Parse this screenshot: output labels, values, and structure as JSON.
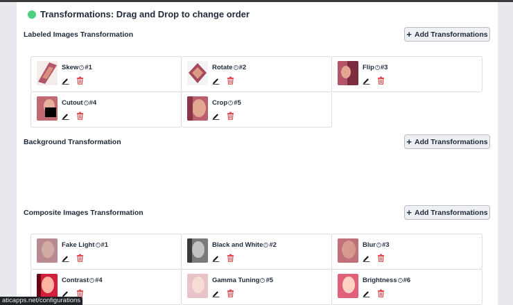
{
  "header": {
    "title": "Transformations: Drag and Drop to change order",
    "status_dot_color": "#4cd07d"
  },
  "sections": [
    {
      "title": "Labeled Images Transformation",
      "add_label": "Add Transformations",
      "cards": [
        {
          "name": "Skew",
          "order": "#1",
          "thumb": "skew"
        },
        {
          "name": "Rotate",
          "order": "#2",
          "thumb": "rotate"
        },
        {
          "name": "Flip",
          "order": "#3",
          "thumb": "flip"
        },
        {
          "name": "Cutout",
          "order": "#4",
          "thumb": "cutout"
        },
        {
          "name": "Crop",
          "order": "#5",
          "thumb": "crop"
        }
      ]
    },
    {
      "title": "Background Transformation",
      "add_label": "Add Transformations",
      "cards": []
    },
    {
      "title": "Composite Images Transformation",
      "add_label": "Add Transformations",
      "cards": [
        {
          "name": "Fake Light",
          "order": "#1",
          "thumb": "fakelight"
        },
        {
          "name": "Black and White",
          "order": "#2",
          "thumb": "bw"
        },
        {
          "name": "Blur",
          "order": "#3",
          "thumb": "blur"
        },
        {
          "name": "Contrast",
          "order": "#4",
          "thumb": "contrast"
        },
        {
          "name": "Gamma Tuning",
          "order": "#5",
          "thumb": "gamma"
        },
        {
          "name": "Brightness",
          "order": "#6",
          "thumb": "brightness"
        }
      ]
    }
  ],
  "icons": {
    "info": "info-icon",
    "edit": "pencil-icon",
    "delete": "trash-icon",
    "add": "plus-icon"
  },
  "colors": {
    "delete": "#e5484d",
    "edit": "#111111",
    "accent": "#4cd07d"
  },
  "status_bar": {
    "url": "aticapps.net/configurations"
  }
}
